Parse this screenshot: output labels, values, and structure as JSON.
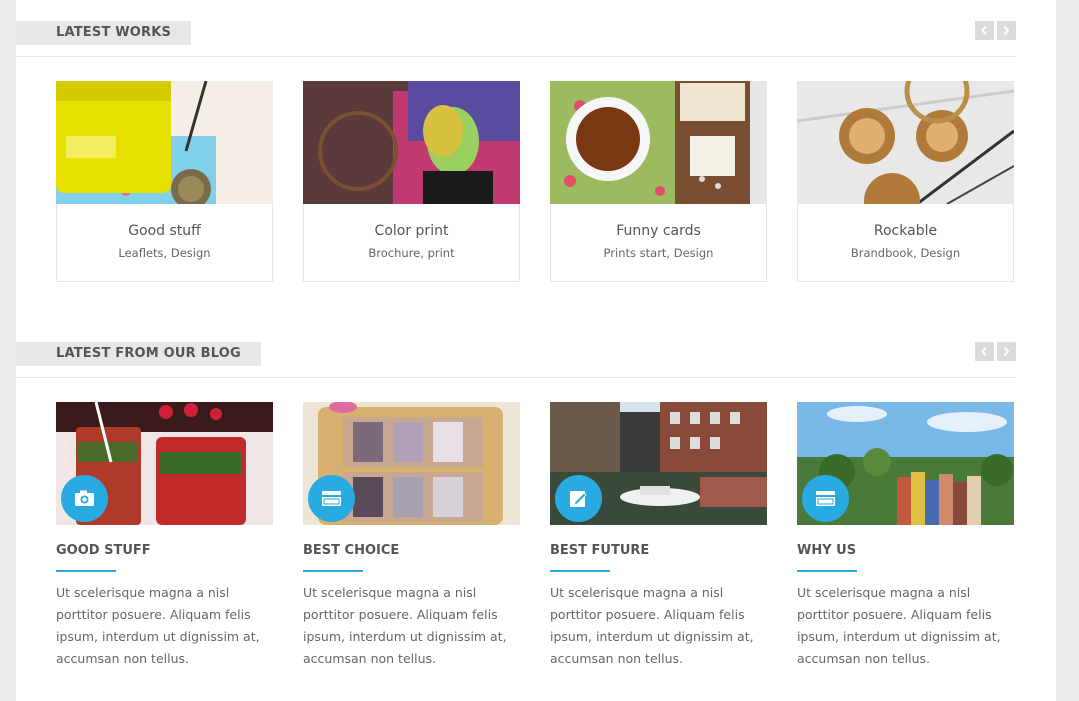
{
  "colors": {
    "accent": "#29aae1",
    "label_bg": "#e7e7e7",
    "heading": "#555555",
    "text": "#666666"
  },
  "works_section": {
    "title": "LATEST WORKS",
    "prev_icon": "chevron-left-icon",
    "next_icon": "chevron-right-icon",
    "items": [
      {
        "title": "Good stuff",
        "subtitle": "Leaflets, Design"
      },
      {
        "title": "Color print",
        "subtitle": "Brochure, print"
      },
      {
        "title": "Funny cards",
        "subtitle": "Prints start, Design"
      },
      {
        "title": "Rockable",
        "subtitle": "Brandbook, Design"
      }
    ]
  },
  "blog_section": {
    "title": "LATEST FROM OUR BLOG",
    "prev_icon": "chevron-left-icon",
    "next_icon": "chevron-right-icon",
    "posts": [
      {
        "title": "GOOD STUFF",
        "icon": "camera-icon",
        "excerpt": "Ut scelerisque magna a nisl porttitor posuere. Aliquam felis ipsum, interdum ut dignissim at, accumsan non tellus."
      },
      {
        "title": "BEST CHOICE",
        "icon": "video-icon",
        "excerpt": "Ut scelerisque magna a nisl porttitor posuere. Aliquam felis ipsum, interdum ut dignissim at, accumsan non tellus."
      },
      {
        "title": "BEST FUTURE",
        "icon": "edit-icon",
        "excerpt": "Ut scelerisque magna a nisl porttitor posuere. Aliquam felis ipsum, interdum ut dignissim at, accumsan non tellus."
      },
      {
        "title": "WHY US",
        "icon": "video-icon",
        "excerpt": "Ut scelerisque magna a nisl porttitor posuere. Aliquam felis ipsum, interdum ut dignissim at, accumsan non tellus."
      }
    ]
  }
}
